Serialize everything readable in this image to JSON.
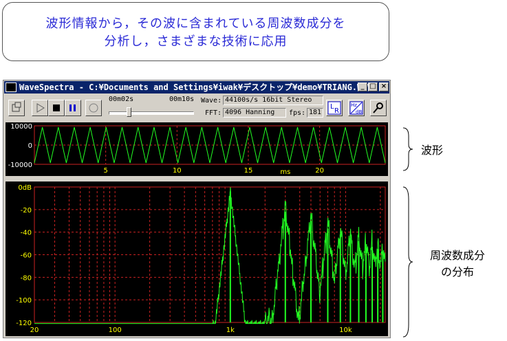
{
  "callout": {
    "line1": "波形情報から，その波に含まれている周波数成分を",
    "line2": "分析し，さまざまな技術に応用"
  },
  "window": {
    "title": "WaveSpectra - C:¥Documents and Settings¥iwak¥デスクトップ¥demo¥TRIANG.WAV",
    "minimize_label": "_",
    "maximize_label": "□",
    "close_label": "×"
  },
  "toolbar": {
    "time_start": "00m02s",
    "time_end": "00m10s",
    "slider_position": 0.22,
    "wave_label": "Wave:",
    "wave_value": "44100s/s 16bit Stereo",
    "fft_label": "FFT:",
    "fft_value": "4096 Hanning",
    "fps_label": "fps:",
    "fps_value": "181",
    "lr_label_l": "L",
    "lr_label_r": "R",
    "hz_label": "Hz",
    "db_label": "dB",
    "icons": [
      "record-icon",
      "play-icon",
      "stop-icon",
      "pause-icon",
      "rec-circle-icon",
      "lr-icon",
      "hz-db-icon",
      "settings-icon"
    ]
  },
  "waveform": {
    "y_ticks": [
      "10000",
      "0",
      "-10000"
    ],
    "x_ticks": [
      "5",
      "10",
      "15",
      "20"
    ],
    "x_unit": "ms",
    "x_max_ms": 24.6,
    "cycles": 22,
    "color": "#22ff22"
  },
  "spectrum": {
    "y_ticks": [
      "0dB",
      "-20",
      "-40",
      "-60",
      "-80",
      "-100",
      "-120"
    ],
    "x_ticks": [
      "20",
      "100",
      "1k",
      "10k"
    ],
    "x_range_hz": [
      20,
      22050
    ],
    "y_range_db": [
      -120,
      0
    ],
    "fundamental_hz": 1000,
    "harmonics_db": [
      [
        1000,
        -4
      ],
      [
        3000,
        -22
      ],
      [
        5000,
        -30
      ],
      [
        7000,
        -37
      ],
      [
        9000,
        -42
      ],
      [
        11000,
        -45
      ],
      [
        13000,
        -48
      ],
      [
        15000,
        -51
      ],
      [
        17000,
        -53
      ],
      [
        19000,
        -55
      ],
      [
        21000,
        -57
      ]
    ],
    "color": "#22ff22",
    "grid_color": "#cc2222"
  },
  "labels": {
    "waveform": "波形",
    "spectrum_line1": "周波数成分",
    "spectrum_line2": "の分布"
  }
}
